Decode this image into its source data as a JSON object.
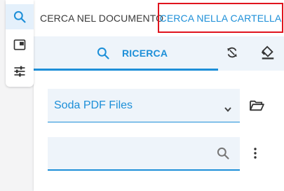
{
  "left_toolbar": {
    "items": [
      {
        "icon": "search-icon",
        "active": true
      },
      {
        "icon": "panel-icon",
        "active": false
      },
      {
        "icon": "sliders-icon",
        "active": false
      }
    ]
  },
  "top_tabs": {
    "document": "CERCA NEL DOCUMENTO",
    "folder": "CERCA NELLA CARTELLA"
  },
  "sub_tabs": {
    "search_label": "RICERCA",
    "refresh_icon": "refresh-icon",
    "clear_icon": "eraser-icon"
  },
  "folder_select": {
    "value": "Soda PDF Files"
  },
  "search": {
    "value": "",
    "placeholder": ""
  },
  "colors": {
    "accent": "#1d8fd8",
    "highlight_border": "#e0141e",
    "field_bg": "#eef4fa"
  }
}
